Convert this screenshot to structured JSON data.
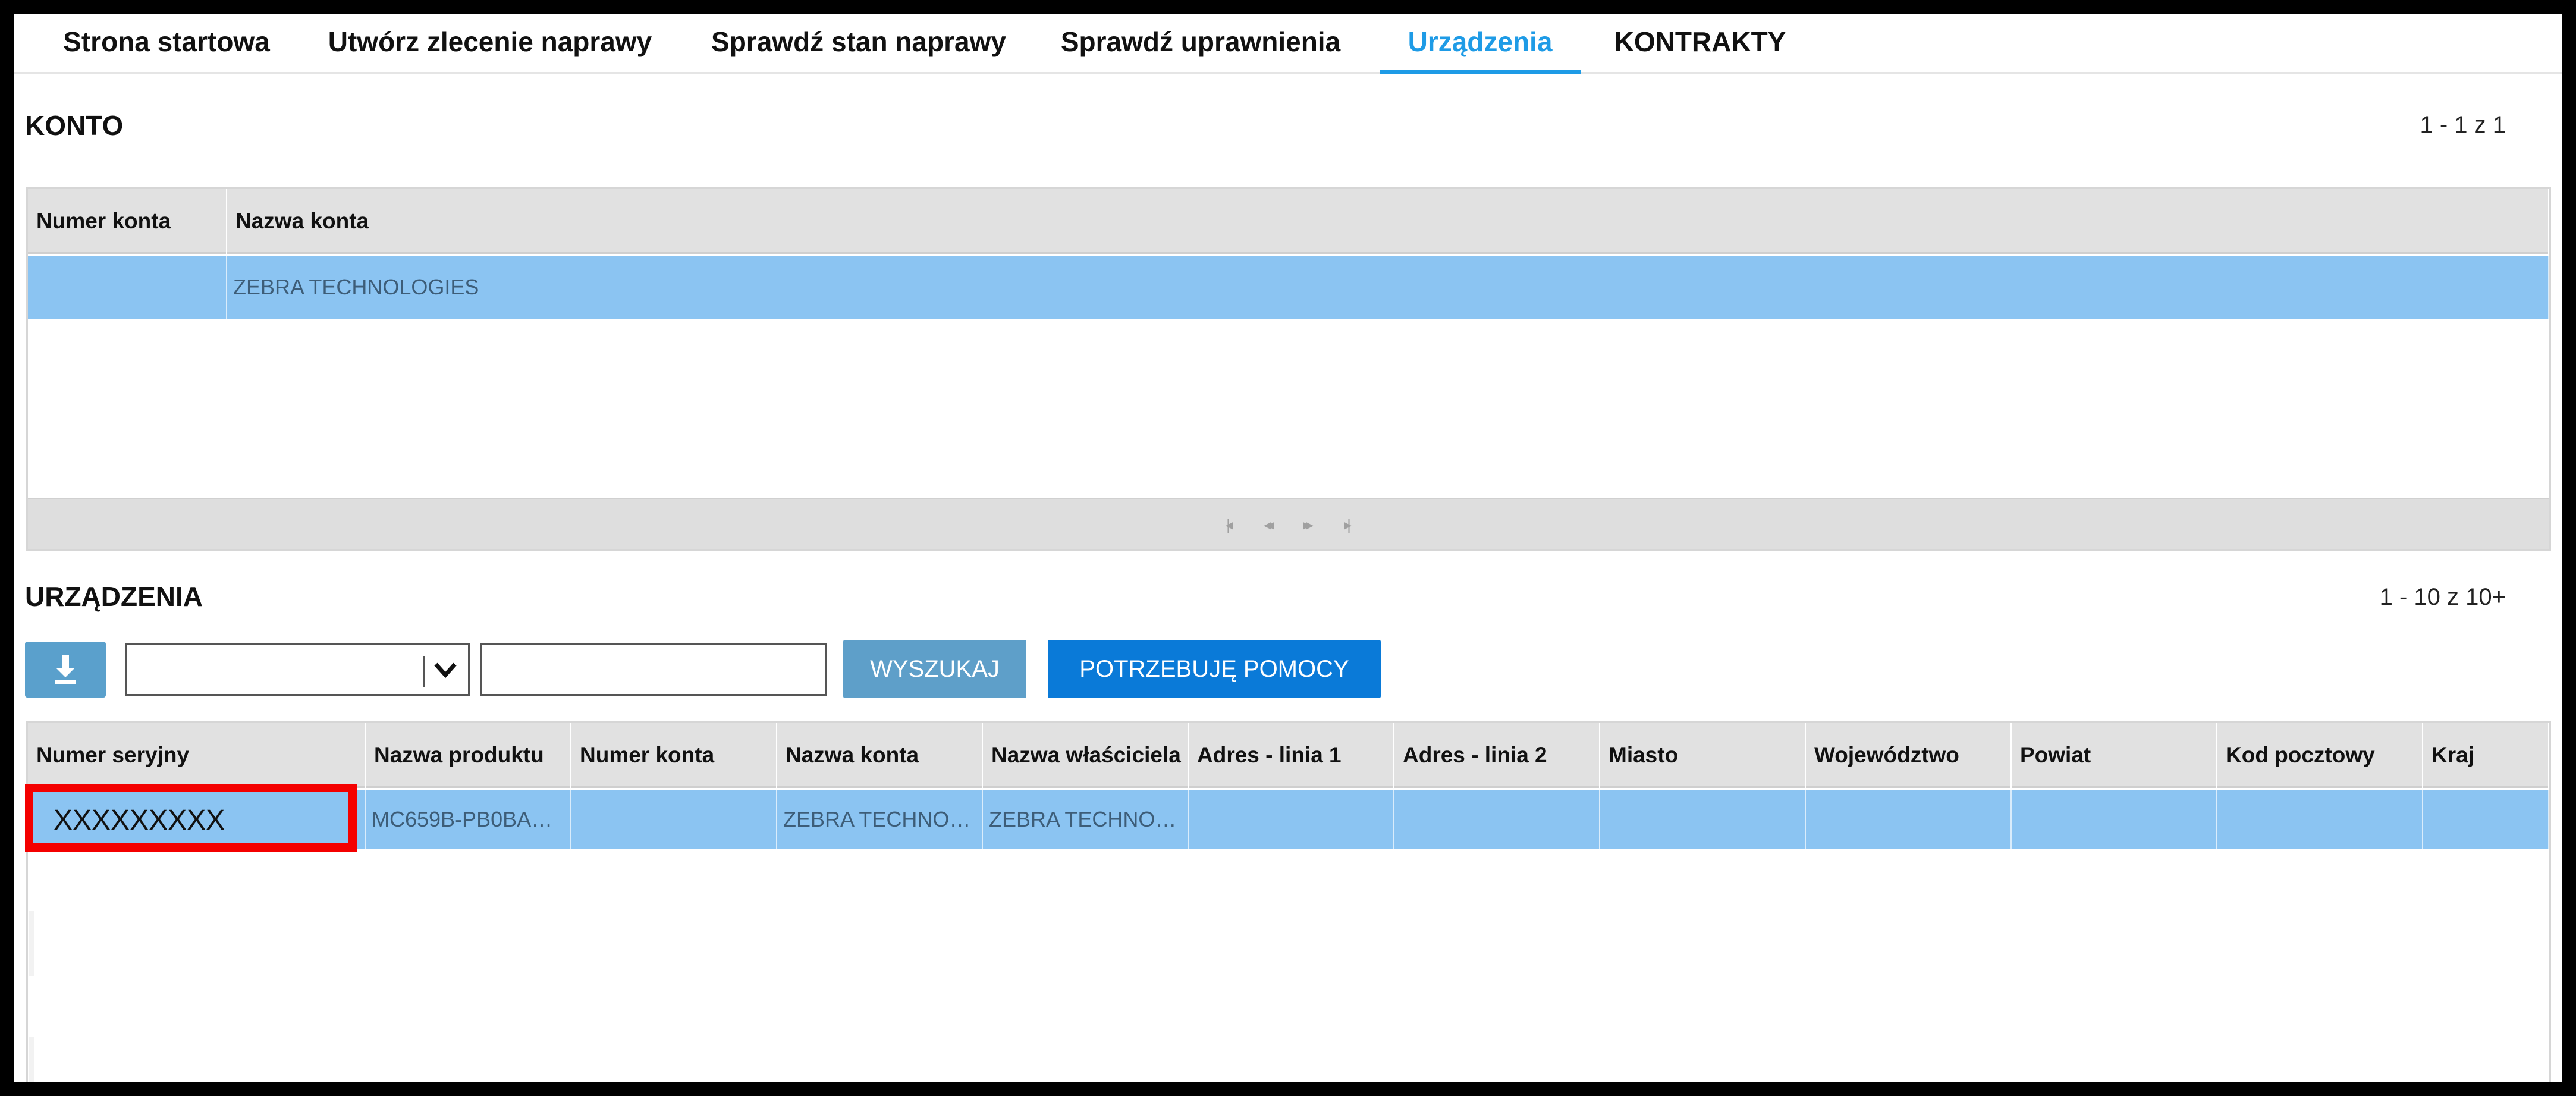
{
  "nav": {
    "tabs": [
      {
        "label": "Strona startowa",
        "active": false
      },
      {
        "label": "Utwórz zlecenie naprawy",
        "active": false
      },
      {
        "label": "Sprawdź stan naprawy",
        "active": false
      },
      {
        "label": "Sprawdź uprawnienia",
        "active": false
      },
      {
        "label": "Urządzenia",
        "active": true
      },
      {
        "label": "KONTRAKTY",
        "active": false
      }
    ]
  },
  "account": {
    "title": "KONTO",
    "pager": "1 - 1 z 1",
    "columns": [
      "Numer konta",
      "Nazwa konta"
    ],
    "rows": [
      {
        "numer_konta": "",
        "nazwa_konta": "ZEBRA TECHNOLOGIES"
      }
    ],
    "pager_icons": [
      "first-page-icon",
      "previous-page-icon",
      "next-page-icon",
      "last-page-icon"
    ]
  },
  "devices": {
    "title": "URZĄDZENIA",
    "pager": "1 - 10 z 10+",
    "select_value": "",
    "search_value": "",
    "search_button": "WYSZUKAJ",
    "help_button": "POTRZEBUJĘ POMOCY",
    "columns": [
      "Numer seryjny",
      "Nazwa produktu",
      "Numer konta",
      "Nazwa konta",
      "Nazwa właściciela",
      "Adres - linia 1",
      "Adres - linia 2",
      "Miasto",
      "Województwo",
      "Powiat",
      "Kod pocztowy",
      "Kraj"
    ],
    "rows": [
      {
        "serial": "XXXXXXXXX",
        "product": "MC659B-PB0BA…",
        "account_no": "",
        "account_name": "ZEBRA TECHNO…",
        "owner": "ZEBRA TECHNO…",
        "addr1": "",
        "addr2": "",
        "city": "",
        "voivodeship": "",
        "county": "",
        "postal": "",
        "country": ""
      }
    ]
  },
  "colors": {
    "accent": "#1e9be6",
    "selected_row": "#8bc4f2",
    "highlight": "#f40000",
    "help_button": "#0a7ad8"
  }
}
